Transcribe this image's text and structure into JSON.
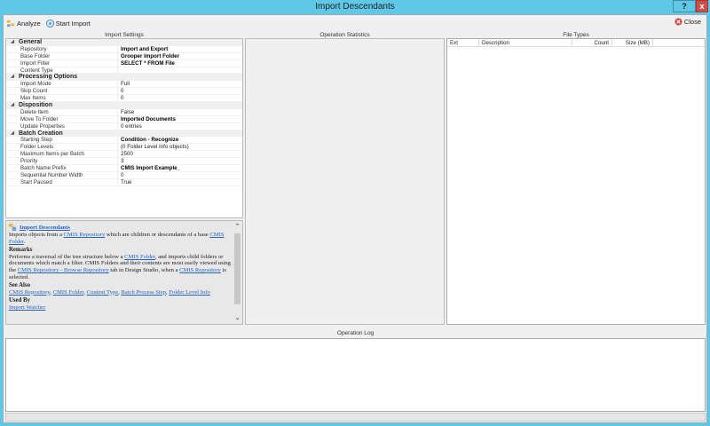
{
  "window": {
    "title": "Import Descendants",
    "help_label": "?",
    "close_label": "x"
  },
  "toolbar": {
    "analyze": "Analyze",
    "start_import": "Start Import",
    "close": "Close"
  },
  "panels": {
    "import_settings": "Import Settings",
    "operation_statistics": "Operation Statistics",
    "file_types": "File Types",
    "operation_log": "Operation Log"
  },
  "settings": [
    {
      "category": "General",
      "rows": [
        {
          "k": "Repository",
          "v": "Import and Export",
          "bold": true
        },
        {
          "k": "Base Folder",
          "v": "Grooper Import Folder",
          "bold": true
        },
        {
          "k": "Import Filter",
          "v": "SELECT * FROM File",
          "bold": true
        },
        {
          "k": "Content Type",
          "v": ""
        }
      ]
    },
    {
      "category": "Processing Options",
      "rows": [
        {
          "k": "Import Mode",
          "v": "Full"
        },
        {
          "k": "Skip Count",
          "v": "0"
        },
        {
          "k": "Max Items",
          "v": "0"
        }
      ]
    },
    {
      "category": "Disposition",
      "rows": [
        {
          "k": "Delete Item",
          "v": "False"
        },
        {
          "k": "Move To Folder",
          "v": "Imported Documents",
          "bold": true
        },
        {
          "k": "Update Properties",
          "v": "0 entries"
        }
      ]
    },
    {
      "category": "Batch Creation",
      "rows": [
        {
          "k": "Starting Step",
          "v": "Condition - Recognize",
          "bold": true
        },
        {
          "k": "Folder Levels",
          "v": "(0 Folder Level Info objects)"
        },
        {
          "k": "Maximum Items per Batch",
          "v": "2500"
        },
        {
          "k": "Priority",
          "v": "3"
        },
        {
          "k": "Batch Name Prefix",
          "v": "CMIS Import Example_",
          "bold": true
        },
        {
          "k": "Sequential Number Width",
          "v": "0"
        },
        {
          "k": "Start Paused",
          "v": "True"
        }
      ]
    }
  ],
  "help": {
    "title": "Import Descendants",
    "intro": [
      "Imports objects from a ",
      "CMIS Repository",
      " which are children or descendants of a base ",
      "CMIS Folder",
      "."
    ],
    "remarks_h": "Remarks",
    "remarks": [
      "Performs a traversal of the tree structure below a ",
      "CMIS Folder",
      ", and imports child folders or documents which match a filter. CMIS Folders and their contents are most easily viewed using the ",
      "CMIS Repository - Browse Repository",
      " tab in Design Studio, when a ",
      "CMIS Repository",
      " is selected."
    ],
    "see_also_h": "See Also",
    "see_also": [
      "CMIS Repository",
      "CMIS Folder",
      "Content Type",
      "Batch Process Step",
      "Folder Level Info"
    ],
    "used_by_h": "Used By",
    "used_by": [
      "Import Watcher"
    ]
  },
  "file_types": {
    "columns": [
      "Ext",
      "Description",
      "Count",
      "Size (MB)"
    ]
  },
  "colors": {
    "titlebar": "#5fc8e6",
    "link": "#2563c0",
    "close": "#c7504a"
  }
}
